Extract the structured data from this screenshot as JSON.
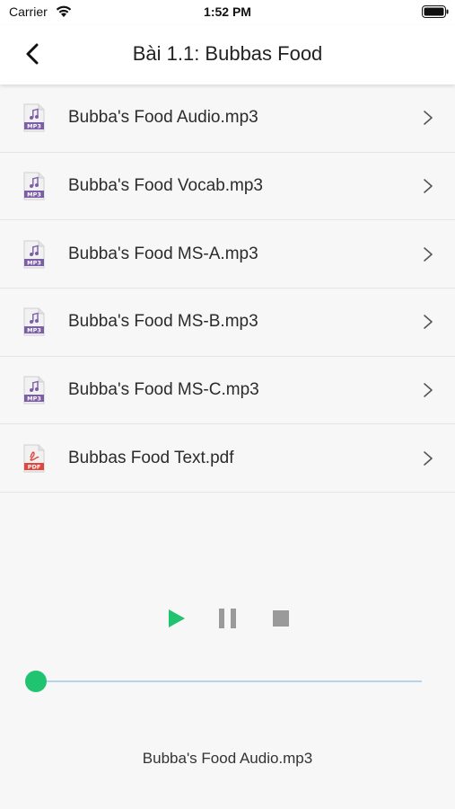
{
  "status_bar": {
    "carrier": "Carrier",
    "time": "1:52 PM"
  },
  "nav": {
    "title": "Bài 1.1: Bubbas Food",
    "back_icon": "chevron-left-icon"
  },
  "files": [
    {
      "name": "Bubba's Food Audio.mp3",
      "type": "mp3"
    },
    {
      "name": "Bubba's Food Vocab.mp3",
      "type": "mp3"
    },
    {
      "name": "Bubba's Food MS-A.mp3",
      "type": "mp3"
    },
    {
      "name": "Bubba's Food MS-B.mp3",
      "type": "mp3"
    },
    {
      "name": "Bubba's Food MS-C.mp3",
      "type": "mp3"
    },
    {
      "name": "Bubbas Food Text.pdf",
      "type": "pdf"
    }
  ],
  "file_icon_labels": {
    "mp3": "MP3",
    "pdf": "PDF"
  },
  "player": {
    "progress": 0,
    "now_playing": "Bubba's Food Audio.mp3"
  },
  "colors": {
    "accent_green": "#20c36f",
    "control_gray": "#9a9a9a",
    "mp3_icon": "#7b5ea7",
    "pdf_icon": "#e0463b",
    "track": "#b7d3ea"
  }
}
